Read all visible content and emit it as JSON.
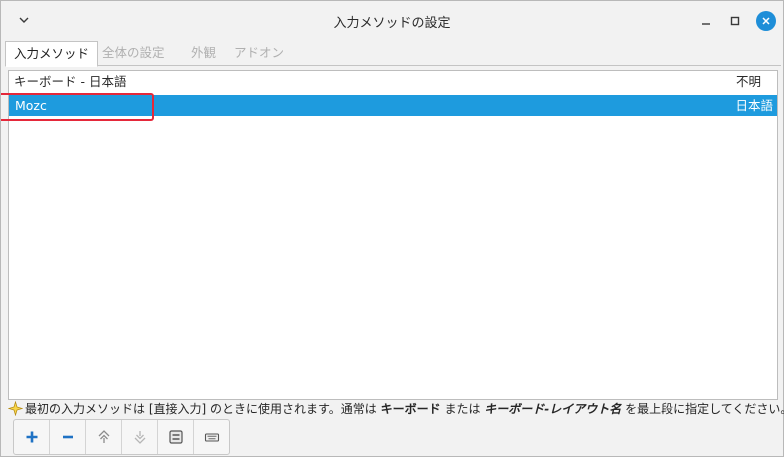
{
  "window": {
    "title": "入力メソッドの設定"
  },
  "tabs": [
    {
      "label": "入力メソッド",
      "active": true
    },
    {
      "label": "全体の設定",
      "active": false
    },
    {
      "label": "外観",
      "active": false
    },
    {
      "label": "アドオン",
      "active": false
    }
  ],
  "list": {
    "header": {
      "name": "キーボード - 日本語",
      "language": "不明"
    },
    "rows": [
      {
        "name": "Mozc",
        "language": "日本語",
        "selected": true
      }
    ]
  },
  "hint": {
    "part1": "最初の入力メソッドは [直接入力] のときに使用されます。通常は ",
    "bold1": "キーボード",
    "part2": " または ",
    "bold2": "キーボード-レイアウト名",
    "part3": " を最上段に指定してください。"
  },
  "toolbar": {
    "icons": [
      "add-icon",
      "remove-icon",
      "move-up-icon",
      "move-down-icon",
      "configure-icon",
      "keyboard-layout-icon"
    ]
  },
  "colors": {
    "selection": "#1e9bde",
    "close_button": "#1e8ed8",
    "highlight_annotation": "#e5283a"
  }
}
